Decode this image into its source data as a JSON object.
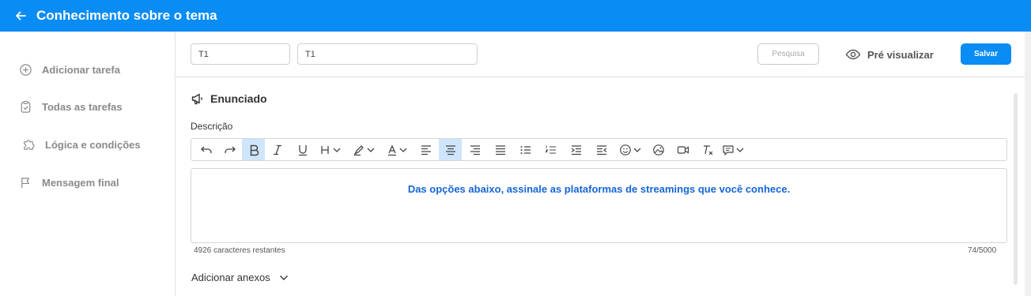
{
  "header": {
    "title": "Conhecimento sobre o tema"
  },
  "sidebar": {
    "items": [
      {
        "label": "Adicionar tarefa",
        "icon": "plus-circle-icon"
      },
      {
        "label": "Todas as tarefas",
        "icon": "clipboard-check-icon"
      },
      {
        "label": "Lógica e condições",
        "icon": "puzzle-icon"
      },
      {
        "label": "Mensagem final",
        "icon": "flag-icon"
      }
    ]
  },
  "topbar": {
    "field1_value": "T1",
    "field2_value": "T1",
    "search_label": "Pesquisa",
    "preview_label": "Pré visualizar",
    "save_label": "Salvar"
  },
  "statement": {
    "section_title": "Enunciado",
    "description_label": "Descrição",
    "editor_text": "Das opções abaixo, assinale as plataformas de streamings que você conhece.",
    "chars_remaining": "4926 caracteres restantes",
    "char_count": "74/5000",
    "attachments_label": "Adicionar anexos"
  },
  "colors": {
    "brand": "#0a8cf5",
    "editor_text": "#1565d8",
    "active_tool": "#cfe5fb"
  }
}
